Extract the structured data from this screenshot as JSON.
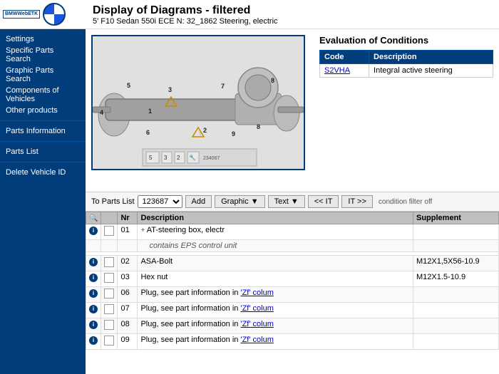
{
  "app": {
    "etk_label": "BMWWebETK",
    "title": "Display of Diagrams - filtered",
    "subtitle": "5' F10 Sedan 550i ECE N: 32_1862 Steering, electric"
  },
  "sidebar": {
    "items": [
      {
        "label": "Settings",
        "id": "settings"
      },
      {
        "label": "Specific Parts Search",
        "id": "specific-parts-search"
      },
      {
        "label": "Graphic Parts Search",
        "id": "graphic-parts-search"
      },
      {
        "label": "Components of Vehicles",
        "id": "components-vehicles"
      },
      {
        "label": "Other products",
        "id": "other-products"
      },
      {
        "label": "Parts Information",
        "id": "parts-information"
      },
      {
        "label": "Parts List",
        "id": "parts-list"
      },
      {
        "label": "Delete Vehicle ID",
        "id": "delete-vehicle-id"
      }
    ]
  },
  "evaluation": {
    "title": "Evaluation of Conditions",
    "columns": [
      "Code",
      "Description"
    ],
    "rows": [
      {
        "code": "S2VHA",
        "description": "Integral active steering"
      }
    ]
  },
  "controls": {
    "parts_list_label": "To Parts List",
    "parts_list_value": "123687",
    "add_btn": "Add",
    "graphic_btn": "Graphic",
    "text_btn": "Text",
    "prev_btn": "<< IT",
    "next_btn": "IT >>",
    "filter_label": "condition filter off"
  },
  "parts_table": {
    "columns": [
      "",
      "",
      "Nr",
      "Description",
      "Supplement"
    ],
    "rows": [
      {
        "info": true,
        "checkbox": true,
        "plus": true,
        "nr": "01",
        "description": "AT-steering box, electr",
        "description2": "contains EPS control unit",
        "supplement": "",
        "link": false
      },
      {
        "info": true,
        "checkbox": true,
        "plus": false,
        "nr": "02",
        "description": "ASA-Bolt",
        "supplement": "M12X1,5X56-10.9",
        "link": false
      },
      {
        "info": true,
        "checkbox": true,
        "plus": false,
        "nr": "03",
        "description": "Hex nut",
        "supplement": "M12X1.5-10.9",
        "link": false
      },
      {
        "info": true,
        "checkbox": true,
        "plus": false,
        "nr": "06",
        "description": "Plug, see part information in 'Zf' colum",
        "supplement": "",
        "link": true
      },
      {
        "info": true,
        "checkbox": true,
        "plus": false,
        "nr": "07",
        "description": "Plug, see part information in 'Zf' colum",
        "supplement": "",
        "link": true
      },
      {
        "info": true,
        "checkbox": true,
        "plus": false,
        "nr": "08",
        "description": "Plug, see part information in 'Zf' colum",
        "supplement": "",
        "link": true
      },
      {
        "info": true,
        "checkbox": true,
        "plus": false,
        "nr": "09",
        "description": "Plug, see part information in 'Zf' colum",
        "supplement": "",
        "link": true
      }
    ]
  },
  "diagram": {
    "part_numbers": [
      "5",
      "3",
      "2"
    ],
    "toolbar_label": "234067"
  }
}
